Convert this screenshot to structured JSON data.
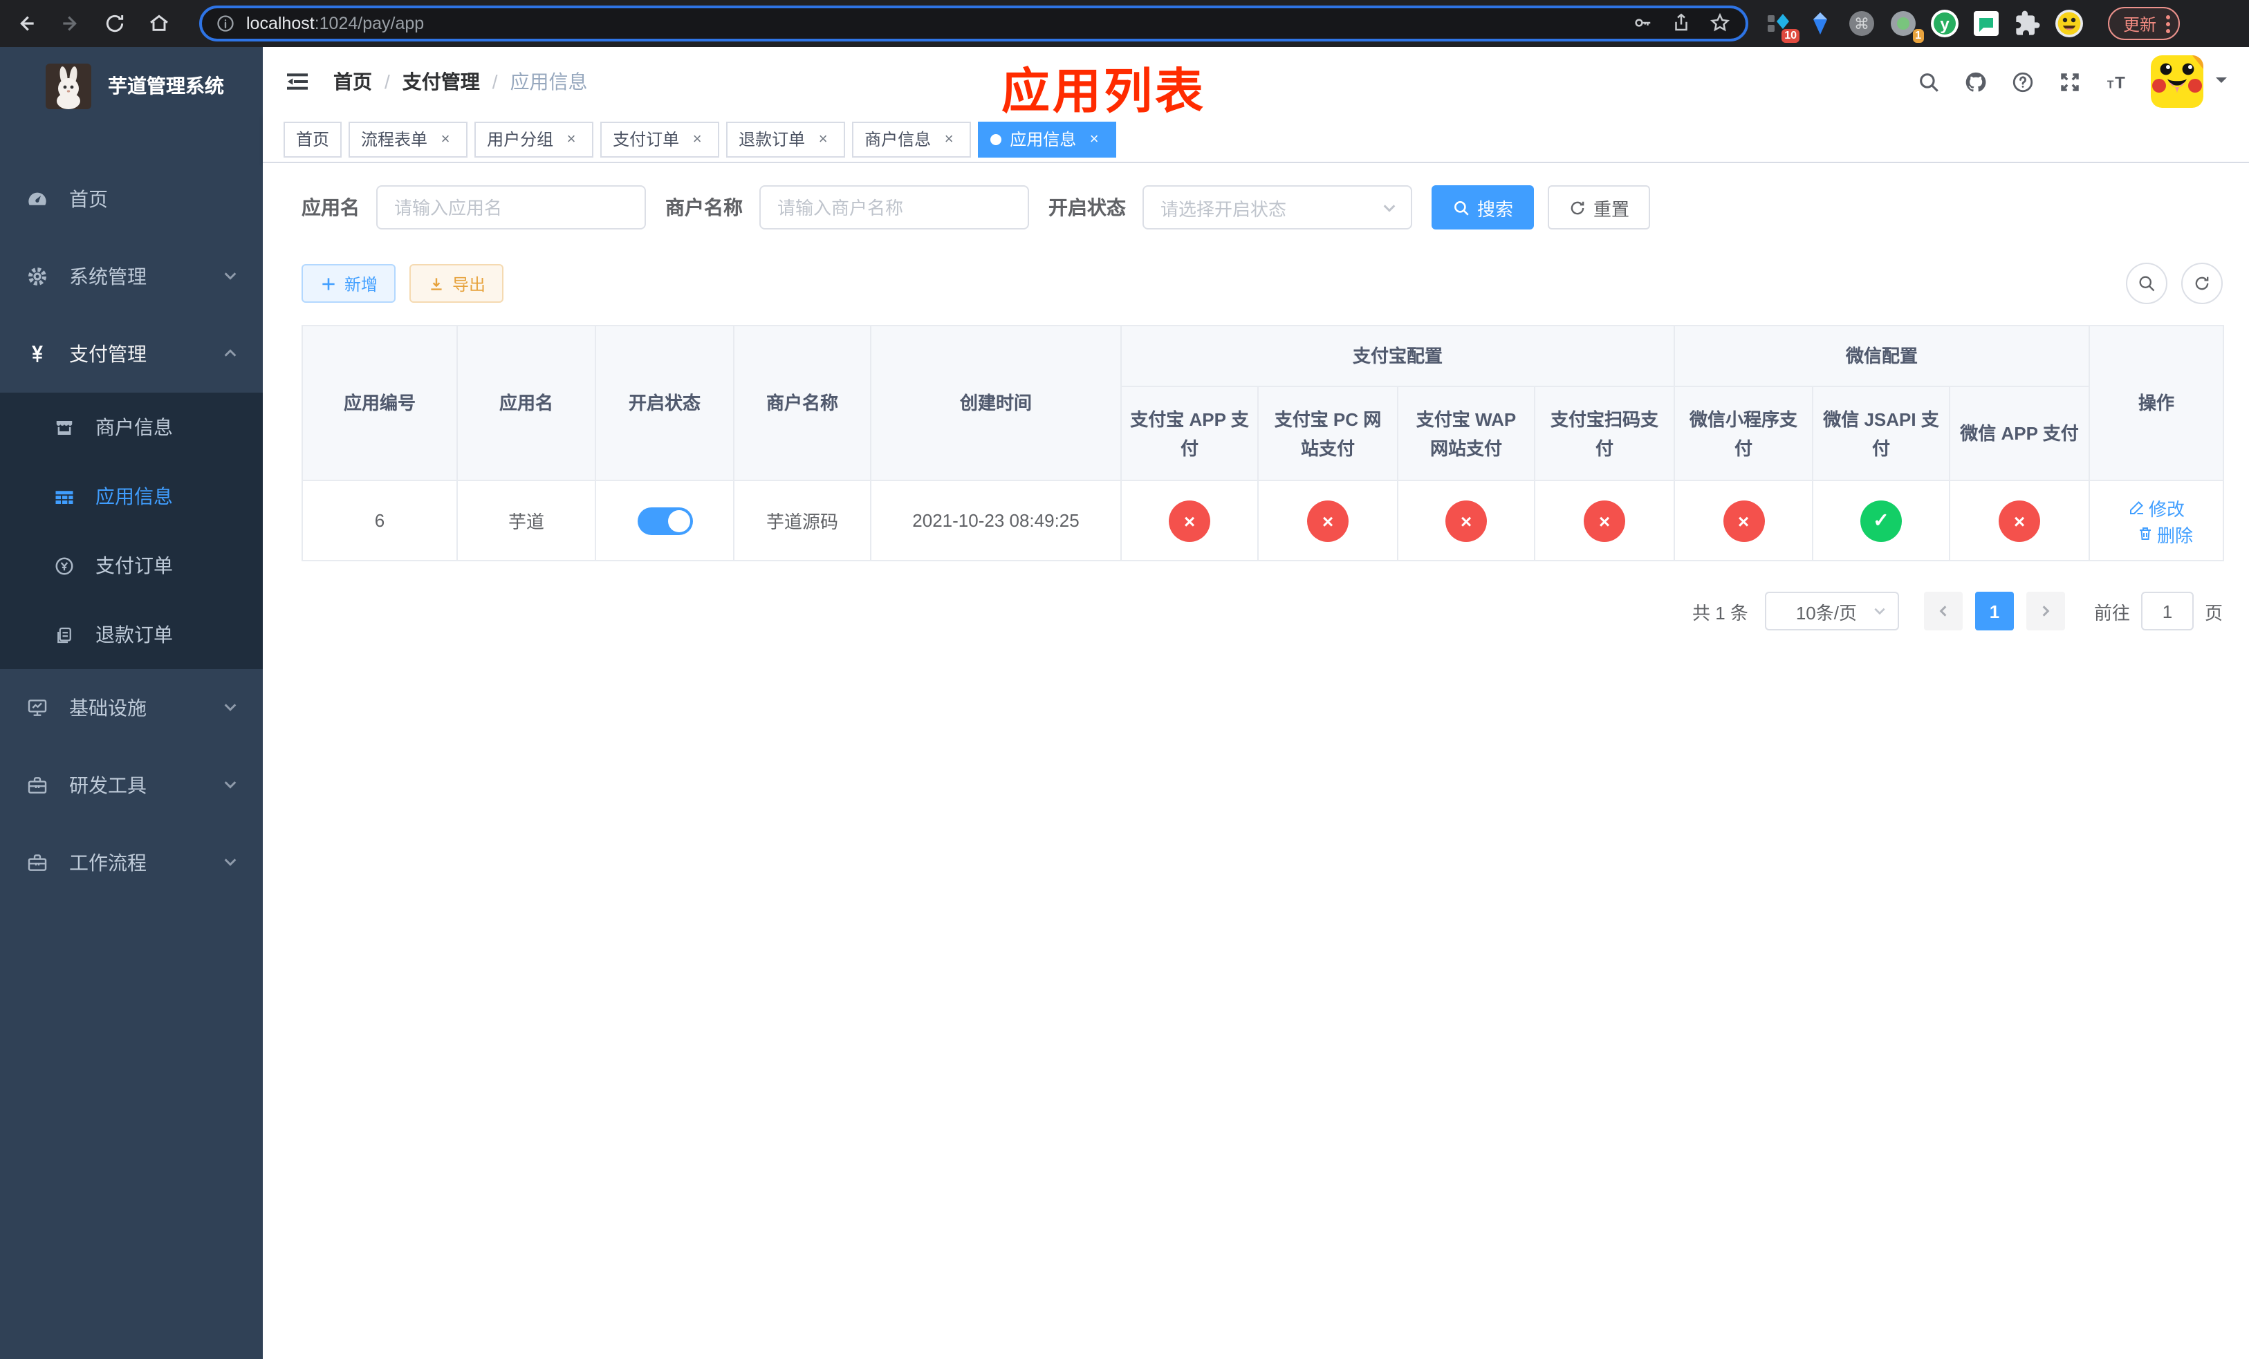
{
  "browser": {
    "url_host": "localhost",
    "url_path": ":1024/pay/app",
    "update_label": "更新",
    "ext_badge_blue_diamond": "10",
    "ext_badge_record": "1"
  },
  "sidebar": {
    "title": "芋道管理系统",
    "items": [
      {
        "label": "首页",
        "icon": "dashboard-icon"
      },
      {
        "label": "系统管理",
        "icon": "gear-icon",
        "expand": "down"
      },
      {
        "label": "支付管理",
        "icon": "yen-icon",
        "expand": "up",
        "active": true
      },
      {
        "label": "商户信息",
        "icon": "store-icon",
        "sub": true
      },
      {
        "label": "应用信息",
        "icon": "grid-icon",
        "sub": true,
        "selected": true
      },
      {
        "label": "支付订单",
        "icon": "coin-icon",
        "sub": true
      },
      {
        "label": "退款订单",
        "icon": "document-icon",
        "sub": true
      },
      {
        "label": "基础设施",
        "icon": "monitor-icon",
        "expand": "down"
      },
      {
        "label": "研发工具",
        "icon": "toolbox-icon",
        "expand": "down"
      },
      {
        "label": "工作流程",
        "icon": "briefcase-icon",
        "expand": "down"
      }
    ]
  },
  "breadcrumb": {
    "separator": "/",
    "items": [
      "首页",
      "支付管理",
      "应用信息"
    ]
  },
  "annotation": "应用列表",
  "tabs": [
    {
      "label": "首页",
      "closable": false,
      "active": false
    },
    {
      "label": "流程表单",
      "closable": true,
      "active": false
    },
    {
      "label": "用户分组",
      "closable": true,
      "active": false
    },
    {
      "label": "支付订单",
      "closable": true,
      "active": false
    },
    {
      "label": "退款订单",
      "closable": true,
      "active": false
    },
    {
      "label": "商户信息",
      "closable": true,
      "active": false
    },
    {
      "label": "应用信息",
      "closable": true,
      "active": true
    }
  ],
  "filters": {
    "app_name_label": "应用名",
    "app_name_placeholder": "请输入应用名",
    "merchant_label": "商户名称",
    "merchant_placeholder": "请输入商户名称",
    "status_label": "开启状态",
    "status_placeholder": "请选择开启状态",
    "search_label": "搜索",
    "reset_label": "重置"
  },
  "toolbar": {
    "add_label": "新增",
    "export_label": "导出"
  },
  "table": {
    "columns": [
      "应用编号",
      "应用名",
      "开启状态",
      "商户名称",
      "创建时间"
    ],
    "groups": [
      {
        "label": "支付宝配置",
        "children": [
          "支付宝 APP 支付",
          "支付宝 PC 网站支付",
          "支付宝 WAP 网站支付",
          "支付宝扫码支付"
        ]
      },
      {
        "label": "微信配置",
        "children": [
          "微信小程序支付",
          "微信 JSAPI 支付",
          "微信 APP 支付"
        ]
      }
    ],
    "action_column": "操作",
    "row": {
      "id": "6",
      "name": "芋道",
      "enabled": true,
      "merchant": "芋道源码",
      "created": "2021-10-23 08:49:25",
      "statuses": [
        false,
        false,
        false,
        false,
        false,
        true,
        false
      ],
      "edit_label": "修改",
      "delete_label": "删除"
    }
  },
  "pagination": {
    "total": "共 1 条",
    "page_size": "10条/页",
    "current_page": "1",
    "goto_label": "前往",
    "goto_value": "1",
    "page_unit": "页"
  },
  "colors": {
    "accent": "#409eff",
    "success": "#13ce66",
    "danger": "#f4514c",
    "warning": "#e6a23c",
    "sidebar_bg": "#304156",
    "submenu_bg": "#1f2d3d",
    "annotation_red": "#ff2b00"
  }
}
